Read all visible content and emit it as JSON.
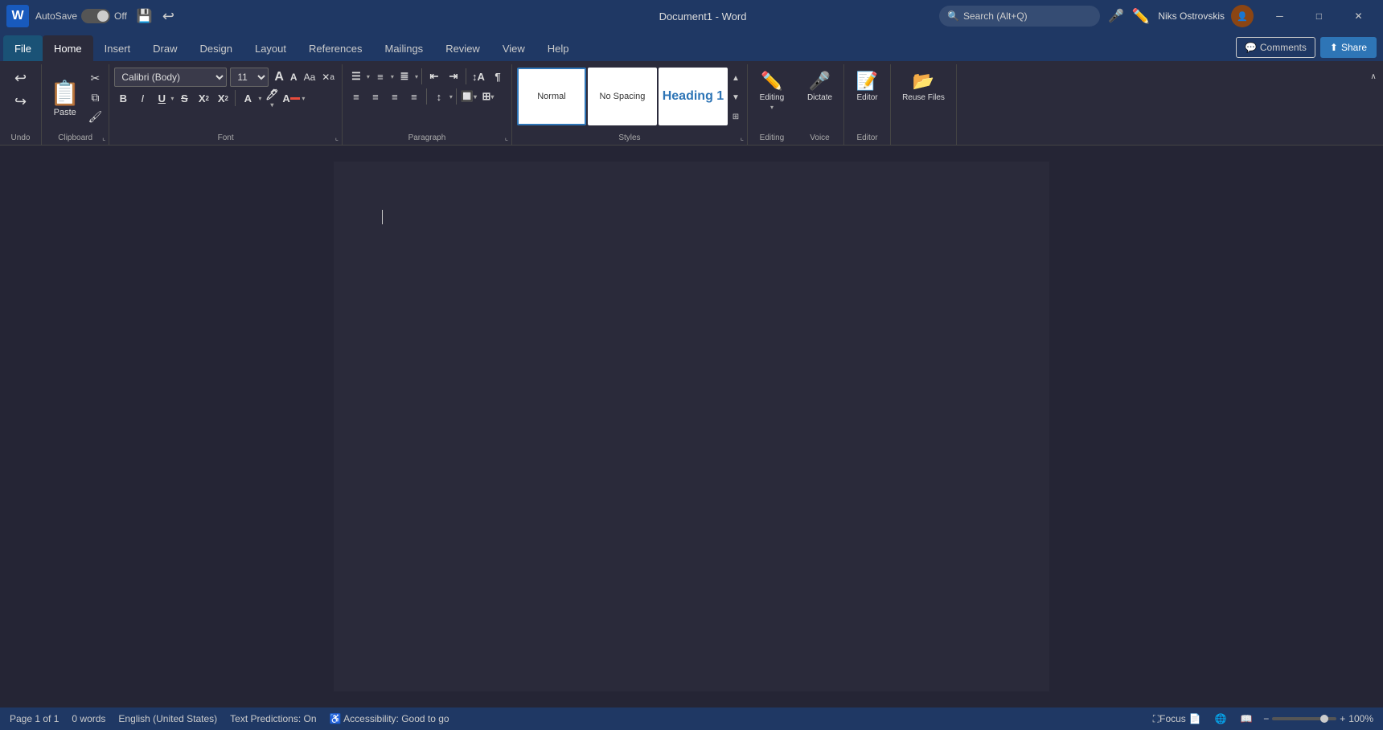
{
  "titlebar": {
    "word_icon": "W",
    "autosave_label": "AutoSave",
    "toggle_state": "Off",
    "save_icon": "💾",
    "doc_title": "Document1  -  Word",
    "search_placeholder": "Search (Alt+Q)",
    "mic_label": "🎤",
    "pen_label": "✏️",
    "user_name": "Niks  Ostrovskis",
    "minimize_icon": "─",
    "maximize_icon": "□",
    "close_icon": "✕"
  },
  "tabs": {
    "file_label": "File",
    "items": [
      "Home",
      "Insert",
      "Draw",
      "Design",
      "Layout",
      "References",
      "Mailings",
      "Review",
      "View",
      "Help"
    ],
    "active": "Home",
    "comments_label": "Comments",
    "share_label": "Share"
  },
  "ribbon": {
    "undo_group_label": "Undo",
    "clipboard_group_label": "Clipboard",
    "font_group_label": "Font",
    "paragraph_group_label": "Paragraph",
    "styles_group_label": "Styles",
    "voice_group_label": "Voice",
    "editor_group_label": "Editor",
    "reuse_files_label": "Reuse\nFiles",
    "editing_group_label": "Editing",
    "paste_label": "Paste",
    "cut_icon": "✂",
    "copy_icon": "⧉",
    "format_painter_icon": "🖌",
    "font_name": "Calibri (Body)",
    "font_size": "11",
    "grow_icon": "A",
    "shrink_icon": "A",
    "change_case_icon": "Aa",
    "clear_formatting": "🧹",
    "bold": "B",
    "italic": "I",
    "underline": "U",
    "strikethrough": "S",
    "subscript": "x₂",
    "superscript": "x²",
    "text_effects": "A",
    "highlight": "🖊",
    "font_color": "A",
    "bullets": "☰",
    "numbering": "≡",
    "multilevel": "≣",
    "indent_decrease": "◀",
    "indent_increase": "▶",
    "sort": "↕",
    "show_para": "¶",
    "align_left": "≡",
    "align_center": "≡",
    "align_right": "≡",
    "justify": "≡",
    "line_spacing": "↕",
    "shading": "🔲",
    "borders": "⊞",
    "styles": [
      {
        "name": "Normal",
        "preview": "Normal",
        "active": true
      },
      {
        "name": "No Spacing",
        "preview": "No Spacing",
        "active": false
      },
      {
        "name": "Heading 1",
        "preview": "Heading 1",
        "active": false
      }
    ],
    "dictate_label": "Dictate",
    "editor_label": "Editor",
    "reuse_label": "Reuse Files",
    "editing_label": "Editing"
  },
  "statusbar": {
    "page_info": "Page 1 of 1",
    "words": "0 words",
    "language": "English (United States)",
    "text_predictions": "Text Predictions: On",
    "accessibility": "Accessibility: Good to go",
    "focus_label": "Focus",
    "zoom_percent": "100%"
  }
}
